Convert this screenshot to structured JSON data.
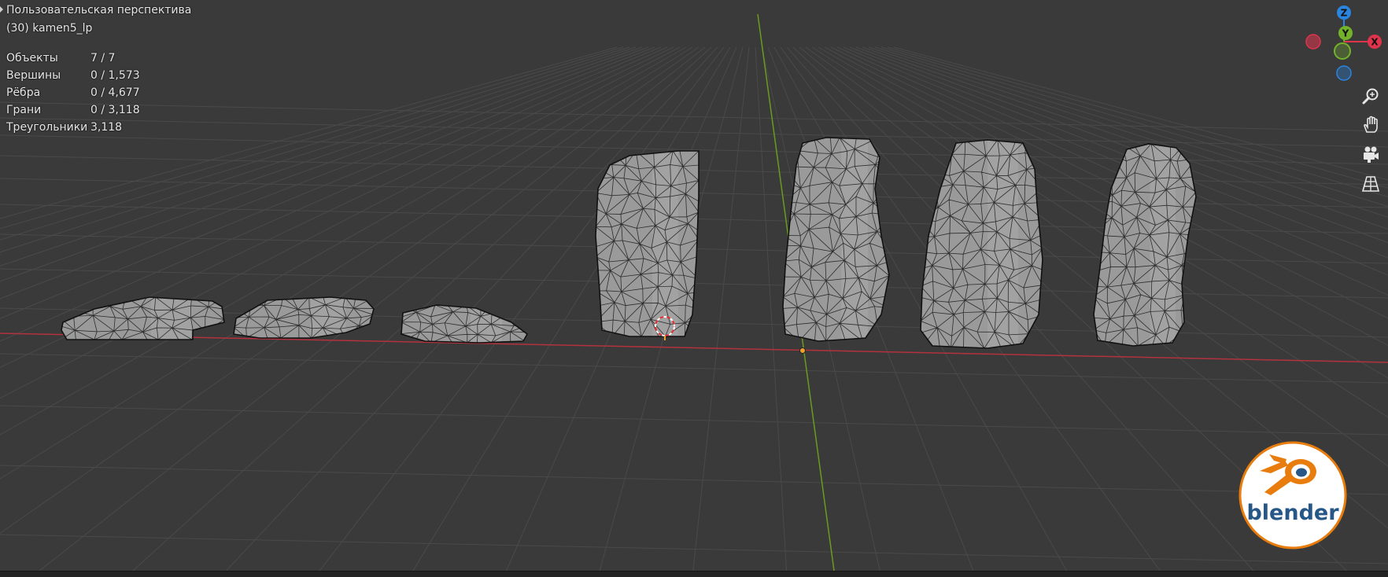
{
  "viewport": {
    "view_name": "Пользовательская перспектива",
    "active_object": "(30) kamen5_lp"
  },
  "stats": [
    {
      "label": "Объекты",
      "value": "7 / 7"
    },
    {
      "label": "Вершины",
      "value": "0 / 1,573"
    },
    {
      "label": "Рёбра",
      "value": "0 / 4,677"
    },
    {
      "label": "Грани",
      "value": "0 / 3,118"
    },
    {
      "label": "Треугольники",
      "value": "3,118"
    }
  ],
  "gizmo": {
    "z_label": "Z",
    "y_label": "Y",
    "x_label": "X",
    "colors": {
      "x": "#e0344c",
      "y": "#73b32a",
      "z": "#2b85e0"
    }
  },
  "nav_buttons": [
    "zoom-icon",
    "pan-hand-icon",
    "camera-icon",
    "grid-perspective-icon"
  ],
  "logo": {
    "text": "blender"
  },
  "colors": {
    "background": "#3a3a3a",
    "grid": "#4a4a4a",
    "x_axis": "#b3323e",
    "y_axis": "#6a9a1f",
    "mesh_fill": "#9a9a9a",
    "wire": "#1a1a1a",
    "origin": "#f0a030"
  }
}
